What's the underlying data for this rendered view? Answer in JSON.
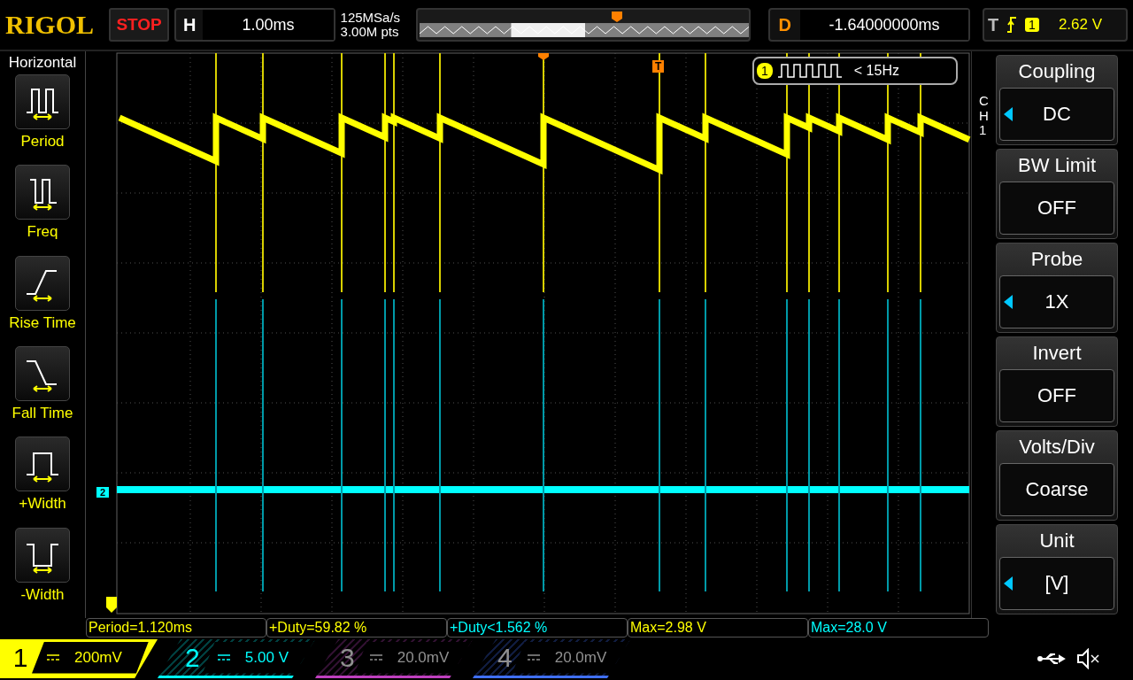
{
  "header": {
    "logo": "RIGOL",
    "run_state": "STOP",
    "timebase": {
      "label": "H",
      "value": "1.00ms"
    },
    "sample_rate": "125MSa/s",
    "memory_depth": "3.00M pts",
    "delay": {
      "label": "D",
      "value": "-1.64000000ms"
    },
    "trigger": {
      "label": "T",
      "source": "1",
      "level": "2.62 V"
    }
  },
  "left_menu": {
    "title": "Horizontal",
    "items": [
      {
        "kind": "period",
        "label": "Period"
      },
      {
        "kind": "freq",
        "label": "Freq"
      },
      {
        "kind": "rise",
        "label": "Rise Time"
      },
      {
        "kind": "fall",
        "label": "Fall Time"
      },
      {
        "kind": "pwidth",
        "label": "+Width"
      },
      {
        "kind": "nwidth",
        "label": "-Width"
      }
    ]
  },
  "display": {
    "trigger_marker": "T",
    "channel_marker": "2",
    "frequency_badge": {
      "source": "1",
      "text": "< 15Hz"
    }
  },
  "right_menu": {
    "channel": "CH1",
    "items": [
      {
        "label": "Coupling",
        "value": "DC",
        "adjustable": true
      },
      {
        "label": "BW Limit",
        "value": "OFF",
        "adjustable": false
      },
      {
        "label": "Probe",
        "value": "1X",
        "adjustable": true
      },
      {
        "label": "Invert",
        "value": "OFF",
        "adjustable": false
      },
      {
        "label": "Volts/Div",
        "value": "Coarse",
        "adjustable": false
      },
      {
        "label": "Unit",
        "value": "[V]",
        "adjustable": true
      }
    ]
  },
  "measurements": [
    {
      "text": "Period=1.120ms",
      "color": "#ffff00"
    },
    {
      "text": "+Duty=59.82 %",
      "color": "#ffff00"
    },
    {
      "text": "+Duty<1.562 %",
      "color": "#00ffff"
    },
    {
      "text": "Max=2.98 V",
      "color": "#ffff00"
    },
    {
      "text": "Max=28.0 V",
      "color": "#00ffff"
    }
  ],
  "channels": [
    {
      "number": "1",
      "scale": "200mV",
      "color": "#ffff00",
      "on": true,
      "selected": true
    },
    {
      "number": "2",
      "scale": "5.00 V",
      "color": "#00ffff",
      "on": true,
      "selected": false
    },
    {
      "number": "3",
      "scale": "20.0mV",
      "color": "#c040c0",
      "on": false,
      "selected": false
    },
    {
      "number": "4",
      "scale": "20.0mV",
      "color": "#4070ff",
      "on": false,
      "selected": false
    }
  ]
}
